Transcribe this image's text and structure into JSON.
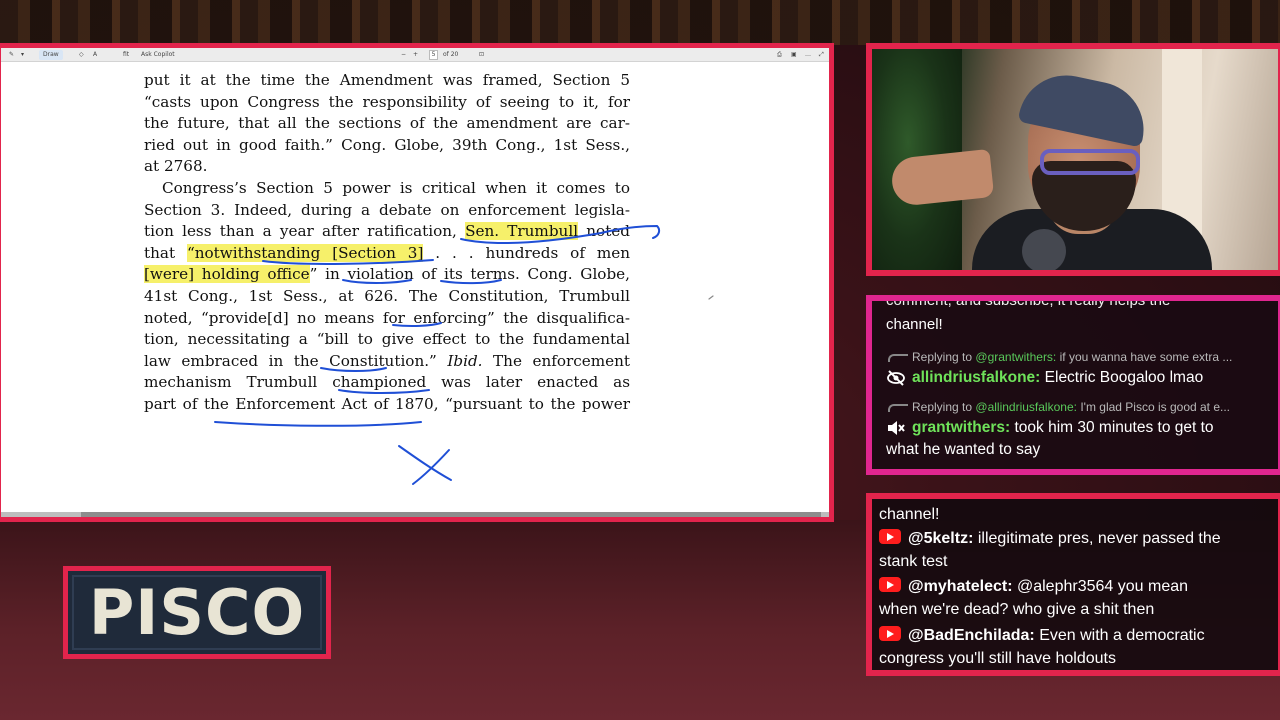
{
  "document": {
    "toolbar": {
      "draw_label": "Draw",
      "zoom_label": "Ask Copilot",
      "zoom_value": "fit",
      "page_current": "5",
      "page_total": "of 20"
    },
    "lines": [
      "put it at the time the Amendment was framed, Section 5",
      "“casts upon Congress the responsibility of seeing to it, for",
      "the future, that all the sections of the amendment are car-",
      "ried out in good faith.” Cong. Globe, 39th Cong., 1st Sess.,",
      "at 2768.",
      "Congress’s Section 5 power is critical when it comes to",
      "Section 3. Indeed, during a debate on enforcement legisla-",
      "tion less than a year after ratification,",
      "Sen. Trumbull",
      "noted",
      "that",
      "“notwithstanding [Section 3]",
      ". . . hundreds of men",
      "[were] holding office",
      "” in violation of its terms. Cong. Globe,",
      "41st Cong., 1st Sess., at 626. The Constitution, Trumbull",
      "noted, “provide[d] no means for enforcing” the disqualifica-",
      "tion, necessitating a “bill to give effect to the fundamental",
      "law embraced in the Constitution.”",
      "Ibid.",
      "The enforcement",
      "mechanism Trumbull championed was later enacted as",
      "part of the Enforcement Act of 1870, “pursuant to the power"
    ]
  },
  "chat_panel_1": {
    "top_text": "comment, and subscribe, it really helps the",
    "top_text_2": "channel!",
    "reply1": {
      "prefix": "Replying to",
      "name": "@grantwithers:",
      "text": "if you wanna have some extra ..."
    },
    "msg1": {
      "icon": "no-eye-icon",
      "name": "allindriusfalkone:",
      "text": "Electric Boogaloo lmao"
    },
    "reply2": {
      "prefix": "Replying to",
      "name": "@allindriusfalkone:",
      "text": "I'm glad Pisco is good at e..."
    },
    "msg2": {
      "icon": "mute-icon",
      "name": "grantwithers:",
      "text": "took him 30 minutes to get to",
      "text2": "what he wanted to say"
    }
  },
  "chat_panel_2": {
    "top_text": "channel!",
    "messages": [
      {
        "name": "@5keltz:",
        "text": "illegitimate pres, never passed the",
        "text2": "stank test"
      },
      {
        "name": "@myhatelect:",
        "text": "@alephr3564 you mean",
        "text2": "when we're dead? who give a shit then"
      },
      {
        "name": "@BadEnchilada:",
        "text": "Even with a democratic",
        "text2": "congress you'll still have holdouts"
      }
    ]
  },
  "nameplate": {
    "text": "PISCO"
  },
  "colors": {
    "frame_red": "#e2244c",
    "frame_pink": "#e0268f",
    "highlight": "#f6f06a",
    "ink_blue": "#1f4fd6",
    "chat_green": "#6fe25a"
  }
}
